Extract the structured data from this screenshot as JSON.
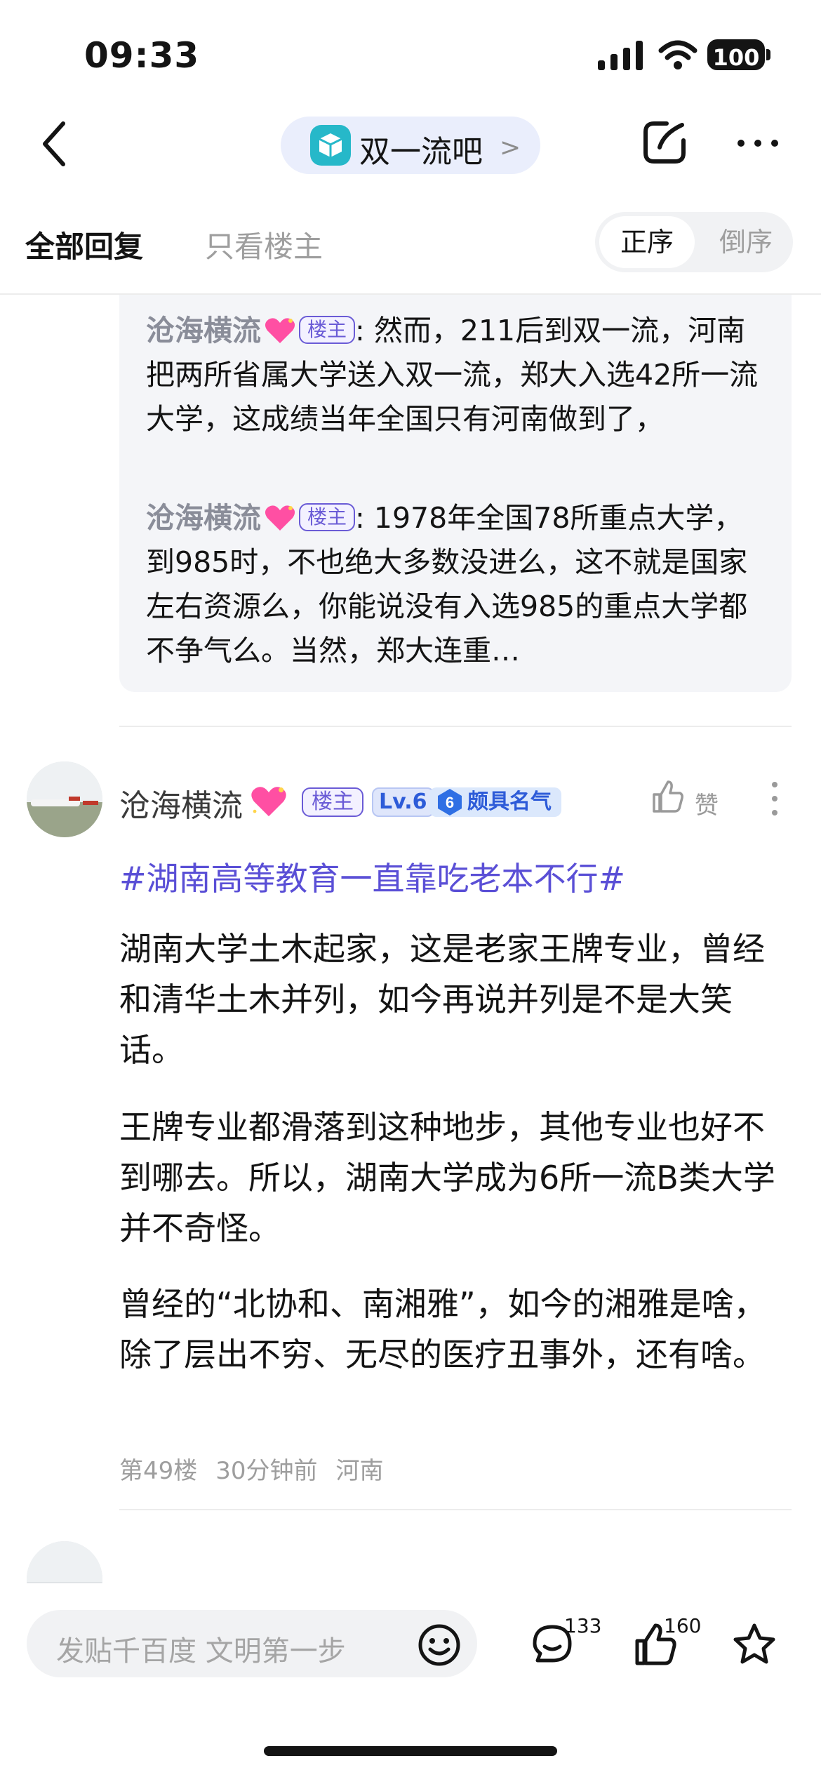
{
  "status_bar": {
    "time": "09:33",
    "battery": "100"
  },
  "nav": {
    "forum_name": "双一流吧",
    "chevron": ">"
  },
  "tabs": {
    "all_replies": "全部回复",
    "op_only": "只看楼主",
    "sort_asc": "正序",
    "sort_desc": "倒序"
  },
  "sub_replies": [
    {
      "author": "沧海横流",
      "tag": "楼主",
      "sep": ":",
      "text": "然而，211后到双一流，河南把两所省属大学送入双一流，郑大入选42所一流大学，这成绩当年全国只有河南做到了，"
    },
    {
      "author": "沧海横流",
      "tag": "楼主",
      "sep": ":",
      "text": "1978年全国78所重点大学，到985时，不也绝大多数没进么，这不就是国家左右资源么，你能说没有入选985的重点大学都不争气么。当然，郑大连重…"
    }
  ],
  "post": {
    "author": "沧海横流",
    "tag": "楼主",
    "level": "Lv.6",
    "fame_num": "6",
    "fame_label": "颇具名气",
    "like_label": "赞",
    "hashtag": "#湖南高等教育一直靠吃老本不行#",
    "paragraphs": [
      "湖南大学土木起家，这是老家王牌专业，曾经和清华土木并列，如今再说并列是不是大笑话。",
      "王牌专业都滑落到这种地步，其他专业也好不到哪去。所以，湖南大学成为6所一流B类大学并不奇怪。",
      "曾经的“北协和、南湘雅”，如今的湘雅是啥，除了层出不穷、无尽的医疗丑事外，还有啥。"
    ],
    "floor": "第49楼",
    "time": "30分钟前",
    "location": "河南"
  },
  "bottom_bar": {
    "input_placeholder": "发贴千百度 文明第一步",
    "comment_count": "133",
    "like_count": "160"
  },
  "colors": {
    "accent": "#5a4fd6",
    "op_tag": "#6a5bd6",
    "level_blue": "#2d5bd8",
    "sub_bg": "#f4f5f8"
  }
}
